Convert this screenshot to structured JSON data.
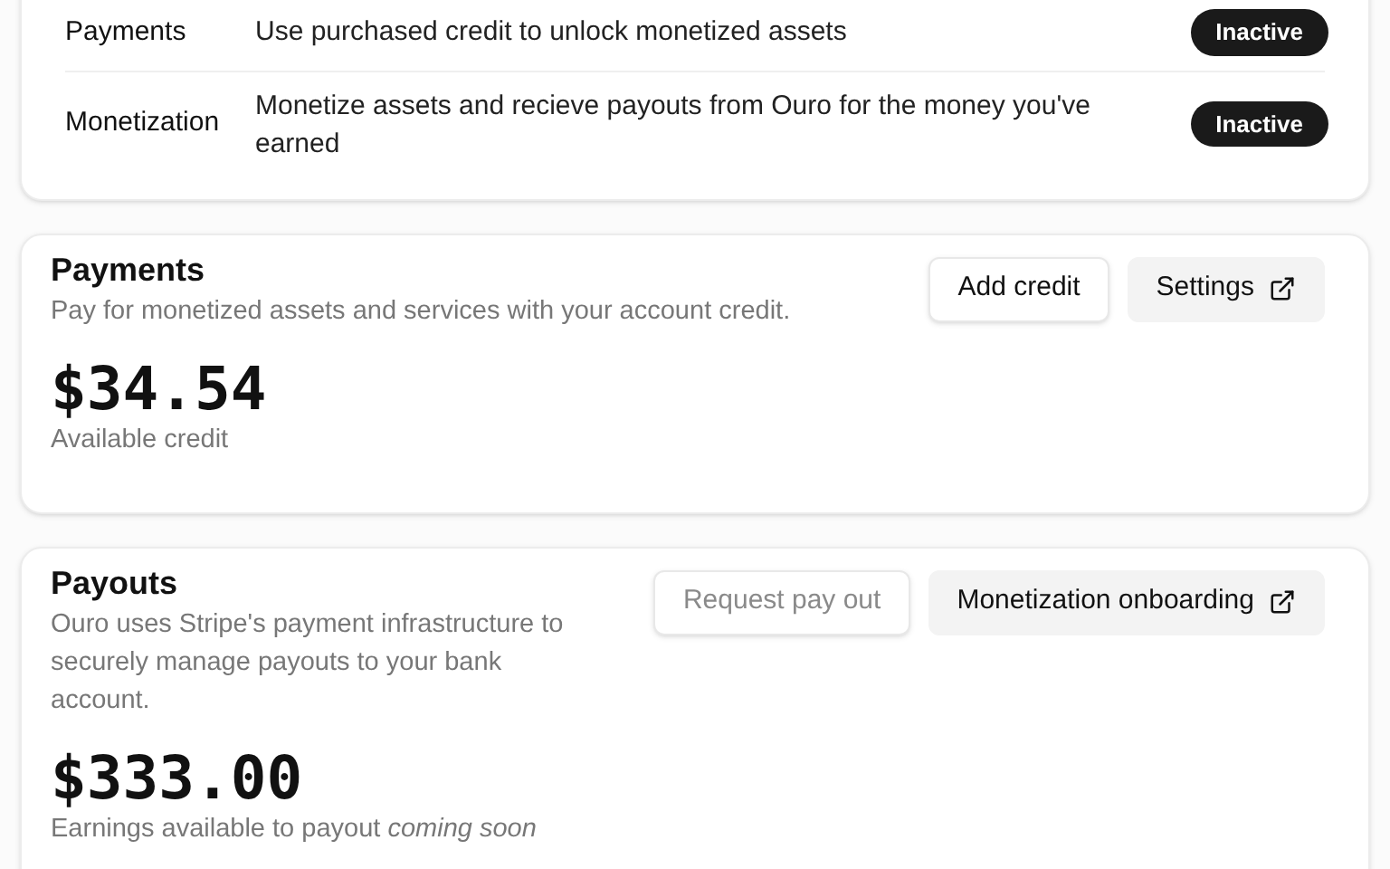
{
  "features": [
    {
      "name": "Payments",
      "description": "Use purchased credit to unlock monetized assets",
      "status": "Inactive",
      "active": false
    },
    {
      "name": "Monetization",
      "description": "Monetize assets and recieve payouts from Ouro for the money you've earned",
      "status": "Inactive",
      "active": false
    }
  ],
  "payments": {
    "title": "Payments",
    "description": "Pay for monetized assets and services with your account credit.",
    "buttons": [
      {
        "label": "Add credit",
        "kind": "outline",
        "disabled": false,
        "external": false
      },
      {
        "label": "Settings",
        "kind": "filled",
        "disabled": false,
        "external": true
      }
    ],
    "amount": "$34.54",
    "caption": "Available credit"
  },
  "payouts": {
    "title": "Payouts",
    "description": "Ouro uses Stripe's payment infrastructure to securely manage payouts to your bank account.",
    "buttons": [
      {
        "label": "Request pay out",
        "kind": "outline",
        "disabled": true,
        "external": false
      },
      {
        "label": "Monetization onboarding",
        "kind": "filled",
        "disabled": false,
        "external": true
      }
    ],
    "amount": "$333.00",
    "caption": "Earnings available to payout *coming soon*"
  }
}
